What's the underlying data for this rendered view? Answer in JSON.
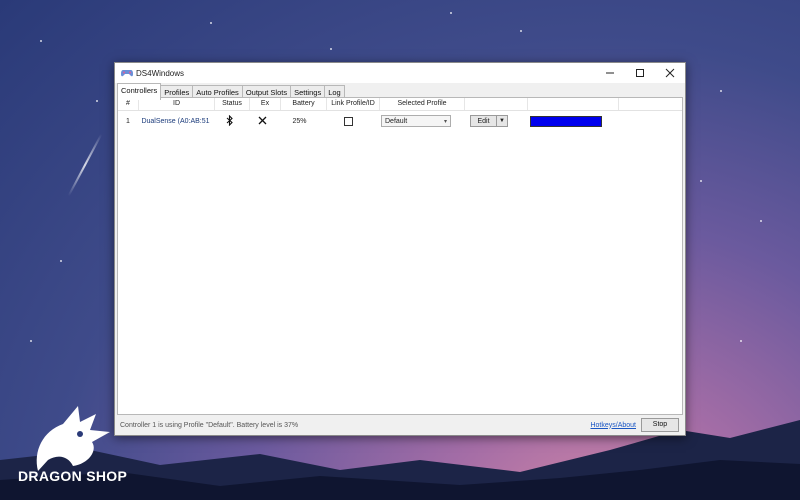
{
  "window": {
    "title": "DS4Windows"
  },
  "tabs": [
    {
      "label": "Controllers"
    },
    {
      "label": "Profiles"
    },
    {
      "label": "Auto Profiles"
    },
    {
      "label": "Output Slots"
    },
    {
      "label": "Settings"
    },
    {
      "label": "Log"
    }
  ],
  "grid": {
    "headers": [
      "#",
      "ID",
      "Status",
      "Ex",
      "Battery",
      "Link Profile/ID",
      "Selected Profile",
      "",
      ""
    ],
    "rows": [
      {
        "index": "1",
        "id": "DualSense (A0:AB:51",
        "status_icon": "bluetooth-icon",
        "ex_icon": "close-icon",
        "battery": "25%",
        "link_profile_checked": false,
        "selected_profile": "Default",
        "edit_label": "Edit",
        "light_color": "#0000ee"
      }
    ]
  },
  "status": {
    "message": "Controller 1 is using Profile \"Default\". Battery level is 37%",
    "hotkeys_link": "Hotkeys/About",
    "stop_label": "Stop"
  },
  "branding": {
    "text": "DRAGON SHOP"
  }
}
